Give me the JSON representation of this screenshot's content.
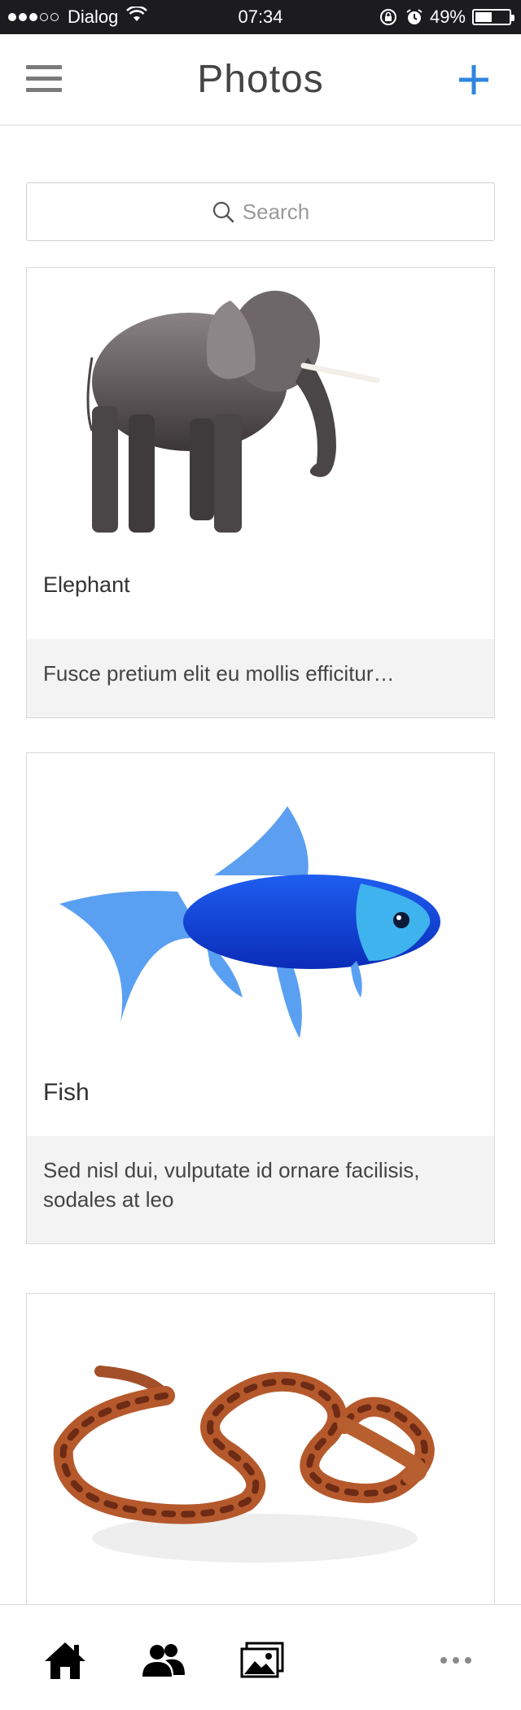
{
  "status_bar": {
    "carrier": "Dialog",
    "time": "07:34",
    "battery": "49%",
    "battery_level": 0.49,
    "signal_filled": 3,
    "signal_total": 5
  },
  "nav": {
    "title": "Photos",
    "menu_icon": "hamburger-menu-icon",
    "add_icon": "plus-icon",
    "accent": "#2f86e0"
  },
  "search": {
    "placeholder": "Search",
    "icon": "search-icon"
  },
  "cards": [
    {
      "title": "Elephant",
      "image": "elephant-photo",
      "description": "Fusce pretium elit eu mollis efficitur…"
    },
    {
      "title": "Fish",
      "image": "fish-photo",
      "description": "Sed nisl dui, vulputate id ornare facilisis, sodales at leo"
    },
    {
      "title": "",
      "image": "snake-photo",
      "description": ""
    }
  ],
  "tab_bar": {
    "items": [
      {
        "icon": "home-icon"
      },
      {
        "icon": "people-icon"
      },
      {
        "icon": "photos-icon"
      },
      {
        "icon": "more-icon"
      }
    ]
  }
}
